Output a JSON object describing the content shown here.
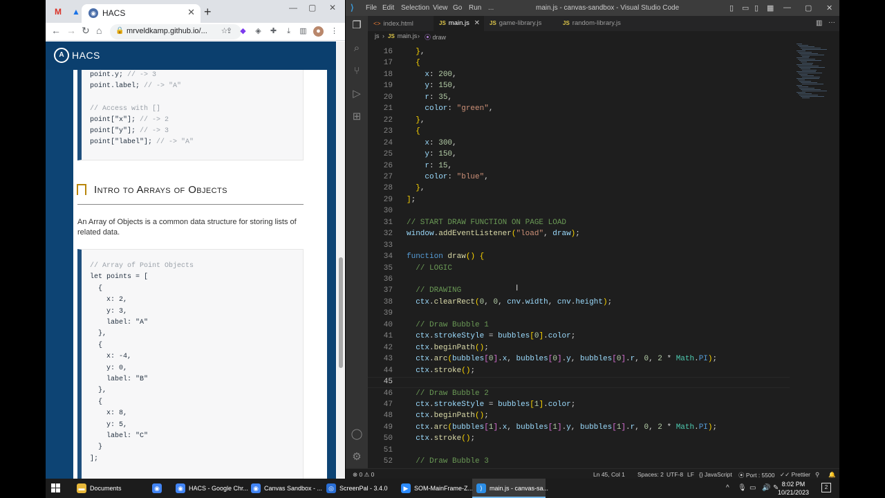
{
  "chrome": {
    "tab_title": "HACS",
    "url": "mrveldkamp.github.io/...",
    "site_name": "HACS",
    "code_top_lines": [
      {
        "code": "point.y; ",
        "comment": "// -> 3"
      },
      {
        "code": "point.label; ",
        "comment": "// -> \"A\""
      },
      {
        "code": "",
        "comment": ""
      },
      {
        "code": "",
        "comment": "// Access with []"
      },
      {
        "code": "point[\"x\"]; ",
        "comment": "// -> 2"
      },
      {
        "code": "point[\"y\"]; ",
        "comment": "// -> 3"
      },
      {
        "code": "point[\"label\"]; ",
        "comment": "// -> \"A\""
      }
    ],
    "section_heading": "Intro to Arrays of Objects",
    "section_paragraph": "An Array of Objects is a common data structure for storing lists of related data.",
    "code_bottom_lines": [
      "// Array of Point Objects",
      "let points = [",
      "  {",
      "    x: 2,",
      "    y: 3,",
      "    label: \"A\"",
      "  },",
      "  {",
      "    x: -4,",
      "    y: 0,",
      "    label: \"B\"",
      "  },",
      "  {",
      "    x: 8,",
      "    y: 5,",
      "    label: \"C\"",
      "  }",
      "];"
    ]
  },
  "vscode": {
    "menu": [
      "File",
      "Edit",
      "Selection",
      "View",
      "Go",
      "Run",
      "..."
    ],
    "window_title": "main.js - canvas-sandbox - Visual Studio Code",
    "tabs": [
      {
        "label": "index.html",
        "kind": "html"
      },
      {
        "label": "main.js",
        "kind": "js",
        "active": true
      },
      {
        "label": "game-library.js",
        "kind": "js"
      },
      {
        "label": "random-library.js",
        "kind": "js"
      }
    ],
    "breadcrumbs": [
      "js",
      "main.js",
      "draw"
    ],
    "first_line_number": 16,
    "current_line": 45,
    "lines": [
      "  },",
      "  {",
      "    x: 200,",
      "    y: 150,",
      "    r: 35,",
      "    color: \"green\",",
      "  },",
      "  {",
      "    x: 300,",
      "    y: 150,",
      "    r: 15,",
      "    color: \"blue\",",
      "  },",
      "];",
      "",
      "// START DRAW FUNCTION ON PAGE LOAD",
      "window.addEventListener(\"load\", draw);",
      "",
      "function draw() {",
      "  // LOGIC",
      "",
      "  // DRAWING",
      "  ctx.clearRect(0, 0, cnv.width, cnv.height);",
      "",
      "  // Draw Bubble 1",
      "  ctx.strokeStyle = bubbles[0].color;",
      "  ctx.beginPath();",
      "  ctx.arc(bubbles[0].x, bubbles[0].y, bubbles[0].r, 0, 2 * Math.PI);",
      "  ctx.stroke();",
      "",
      "  // Draw Bubble 2",
      "  ctx.strokeStyle = bubbles[1].color;",
      "  ctx.beginPath();",
      "  ctx.arc(bubbles[1].x, bubbles[1].y, bubbles[1].r, 0, 2 * Math.PI);",
      "  ctx.stroke();",
      "",
      "  // Draw Bubble 3"
    ],
    "status": {
      "errors": "0",
      "warnings": "0",
      "position": "Ln 45, Col 1",
      "spaces": "Spaces: 2",
      "encoding": "UTF-8",
      "eol": "LF",
      "language": "JavaScript",
      "port": "Port : 5500",
      "formatter": "Prettier"
    }
  },
  "taskbar": {
    "items": [
      {
        "label": "Documents",
        "icon": "folder-icon",
        "color": "#e8b83a"
      },
      {
        "label": "",
        "icon": "chrome-icon",
        "color": "#4285f4"
      },
      {
        "label": "HACS - Google Chr...",
        "icon": "chrome-icon",
        "color": "#4285f4"
      },
      {
        "label": "Canvas Sandbox - ...",
        "icon": "chrome-icon",
        "color": "#4285f4"
      },
      {
        "label": "ScreenPal - 3.4.0",
        "icon": "screenpal-icon",
        "color": "#2a6fd6"
      },
      {
        "label": "SOM-MainFrame-Z...",
        "icon": "zoom-icon",
        "color": "#2d8cff"
      },
      {
        "label": "main.js - canvas-sa...",
        "icon": "vscode-icon",
        "color": "#2c8ee6",
        "active": true
      }
    ],
    "time": "8:02 PM",
    "date": "10/21/2023",
    "notification_count": "2"
  },
  "colors": {
    "accent": "#0b3f6e",
    "editor_bg": "#1e1e1e",
    "js_badge": "#e0c84a"
  }
}
